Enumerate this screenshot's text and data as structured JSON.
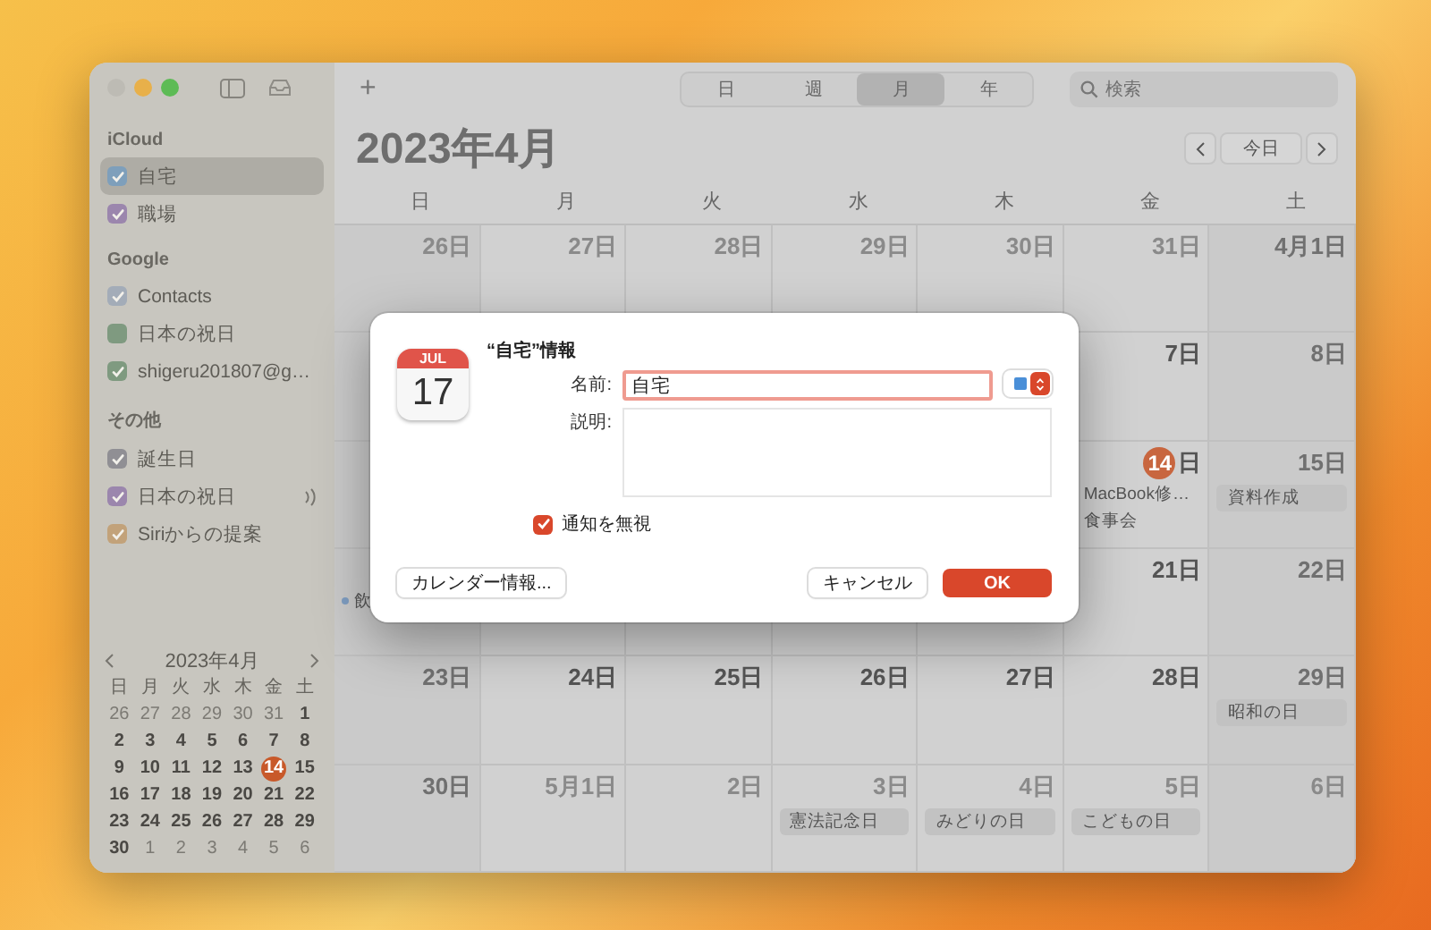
{
  "sidebar": {
    "groups": [
      {
        "title": "iCloud",
        "items": [
          {
            "label": "自宅",
            "checked": true,
            "selected": true,
            "subscribed": false,
            "color": "#7e9fbb"
          },
          {
            "label": "職場",
            "checked": true,
            "selected": false,
            "subscribed": false,
            "color": "#9b86ad"
          }
        ]
      },
      {
        "title": "Google",
        "items": [
          {
            "label": "Contacts",
            "checked": true,
            "selected": false,
            "subscribed": false,
            "color": "#a3acb8"
          },
          {
            "label": "日本の祝日",
            "checked": false,
            "selected": false,
            "subscribed": false,
            "color": "#7f9a80"
          },
          {
            "label": "shigeru201807@g…",
            "checked": true,
            "selected": false,
            "subscribed": false,
            "color": "#7f9a80"
          }
        ]
      },
      {
        "title": "その他",
        "items": [
          {
            "label": "誕生日",
            "checked": true,
            "selected": false,
            "subscribed": false,
            "color": "#908f94"
          },
          {
            "label": "日本の祝日",
            "checked": true,
            "selected": false,
            "subscribed": true,
            "color": "#9b86ad"
          },
          {
            "label": "Siriからの提案",
            "checked": true,
            "selected": false,
            "subscribed": false,
            "color": "#c2a27a"
          }
        ]
      }
    ],
    "mini_calendar": {
      "title": "2023年4月",
      "weekdays": [
        "日",
        "月",
        "火",
        "水",
        "木",
        "金",
        "土"
      ],
      "weeks": [
        [
          {
            "d": "26",
            "muted": true,
            "today": false
          },
          {
            "d": "27",
            "muted": true,
            "today": false
          },
          {
            "d": "28",
            "muted": true,
            "today": false
          },
          {
            "d": "29",
            "muted": true,
            "today": false
          },
          {
            "d": "30",
            "muted": true,
            "today": false
          },
          {
            "d": "31",
            "muted": true,
            "today": false
          },
          {
            "d": "1",
            "muted": false,
            "today": false
          }
        ],
        [
          {
            "d": "2",
            "muted": false,
            "today": false
          },
          {
            "d": "3",
            "muted": false,
            "today": false
          },
          {
            "d": "4",
            "muted": false,
            "today": false
          },
          {
            "d": "5",
            "muted": false,
            "today": false
          },
          {
            "d": "6",
            "muted": false,
            "today": false
          },
          {
            "d": "7",
            "muted": false,
            "today": false
          },
          {
            "d": "8",
            "muted": false,
            "today": false
          }
        ],
        [
          {
            "d": "9",
            "muted": false,
            "today": false
          },
          {
            "d": "10",
            "muted": false,
            "today": false
          },
          {
            "d": "11",
            "muted": false,
            "today": false
          },
          {
            "d": "12",
            "muted": false,
            "today": false
          },
          {
            "d": "13",
            "muted": false,
            "today": false
          },
          {
            "d": "14",
            "muted": false,
            "today": true
          },
          {
            "d": "15",
            "muted": false,
            "today": false
          }
        ],
        [
          {
            "d": "16",
            "muted": false,
            "today": false
          },
          {
            "d": "17",
            "muted": false,
            "today": false
          },
          {
            "d": "18",
            "muted": false,
            "today": false
          },
          {
            "d": "19",
            "muted": false,
            "today": false
          },
          {
            "d": "20",
            "muted": false,
            "today": false
          },
          {
            "d": "21",
            "muted": false,
            "today": false
          },
          {
            "d": "22",
            "muted": false,
            "today": false
          }
        ],
        [
          {
            "d": "23",
            "muted": false,
            "today": false
          },
          {
            "d": "24",
            "muted": false,
            "today": false
          },
          {
            "d": "25",
            "muted": false,
            "today": false
          },
          {
            "d": "26",
            "muted": false,
            "today": false
          },
          {
            "d": "27",
            "muted": false,
            "today": false
          },
          {
            "d": "28",
            "muted": false,
            "today": false
          },
          {
            "d": "29",
            "muted": false,
            "today": false
          }
        ],
        [
          {
            "d": "30",
            "muted": false,
            "today": false
          },
          {
            "d": "1",
            "muted": true,
            "today": false
          },
          {
            "d": "2",
            "muted": true,
            "today": false
          },
          {
            "d": "3",
            "muted": true,
            "today": false
          },
          {
            "d": "4",
            "muted": true,
            "today": false
          },
          {
            "d": "5",
            "muted": true,
            "today": false
          },
          {
            "d": "6",
            "muted": true,
            "today": false
          }
        ]
      ]
    }
  },
  "toolbar": {
    "add": "+",
    "views": [
      {
        "label": "日",
        "selected": false
      },
      {
        "label": "週",
        "selected": false
      },
      {
        "label": "月",
        "selected": true
      },
      {
        "label": "年",
        "selected": false
      }
    ],
    "search": {
      "placeholder": "検索"
    }
  },
  "header": {
    "title": "2023年4月",
    "today": "今日"
  },
  "weekdays": [
    "日",
    "月",
    "火",
    "水",
    "木",
    "金",
    "土"
  ],
  "weeks": [
    {
      "days": [
        {
          "label": "26日",
          "muted": true,
          "today": false
        },
        {
          "label": "27日",
          "muted": true,
          "today": false
        },
        {
          "label": "28日",
          "muted": true,
          "today": false
        },
        {
          "label": "29日",
          "muted": true,
          "today": false
        },
        {
          "label": "30日",
          "muted": true,
          "today": false
        },
        {
          "label": "31日",
          "muted": true,
          "today": false
        },
        {
          "label": "4月1日",
          "muted": false,
          "today": false
        }
      ]
    },
    {
      "days": [
        {
          "label": "7日",
          "muted": false,
          "today": false
        },
        {
          "label": "8日",
          "muted": false,
          "today": false
        }
      ]
    },
    {
      "days": [
        {
          "label": "14",
          "suffix": "日",
          "muted": false,
          "today": true,
          "events": [
            {
              "title": "MacBook修…",
              "kind": "timed"
            },
            {
              "title": "食事会",
              "kind": "timed"
            }
          ]
        },
        {
          "label": "15日",
          "muted": false,
          "today": false,
          "events": [
            {
              "title": "資料作成",
              "kind": "allday"
            }
          ]
        }
      ]
    },
    {
      "first_day": {
        "events": [
          {
            "title": "飲",
            "kind": "timed"
          }
        ]
      },
      "days": [
        {
          "label": "21日",
          "muted": false,
          "today": false
        },
        {
          "label": "22日",
          "muted": false,
          "today": false
        }
      ]
    },
    {
      "days": [
        {
          "label": "23日",
          "muted": false,
          "today": false
        },
        {
          "label": "24日",
          "muted": false,
          "today": false
        },
        {
          "label": "25日",
          "muted": false,
          "today": false
        },
        {
          "label": "26日",
          "muted": false,
          "today": false
        },
        {
          "label": "27日",
          "muted": false,
          "today": false
        },
        {
          "label": "28日",
          "muted": false,
          "today": false
        },
        {
          "label": "29日",
          "muted": false,
          "today": false,
          "events": [
            {
              "title": "昭和の日",
              "kind": "allday"
            }
          ]
        }
      ]
    },
    {
      "days": [
        {
          "label": "30日",
          "muted": false,
          "today": false
        },
        {
          "label": "5月1日",
          "muted": true,
          "today": false
        },
        {
          "label": "2日",
          "muted": true,
          "today": false
        },
        {
          "label": "3日",
          "muted": true,
          "today": false,
          "events": [
            {
              "title": "憲法記念日",
              "kind": "allday"
            }
          ]
        },
        {
          "label": "4日",
          "muted": true,
          "today": false,
          "events": [
            {
              "title": "みどりの日",
              "kind": "allday"
            }
          ]
        },
        {
          "label": "5日",
          "muted": true,
          "today": false,
          "events": [
            {
              "title": "こどもの日",
              "kind": "allday"
            }
          ]
        },
        {
          "label": "6日",
          "muted": true,
          "today": false
        }
      ]
    }
  ],
  "dialog": {
    "icon": {
      "month": "JUL",
      "day": "17"
    },
    "title": "“自宅”情報",
    "name_label": "名前:",
    "name_value": "自宅",
    "color": "#4a8fd8",
    "description_label": "説明:",
    "checkbox": {
      "label": "通知を無視",
      "checked": true
    },
    "buttons": [
      {
        "label": "カレンダー情報...",
        "kind": "secondary"
      },
      {
        "label": "キャンセル",
        "kind": "secondary"
      },
      {
        "label": "OK",
        "kind": "default"
      }
    ]
  }
}
